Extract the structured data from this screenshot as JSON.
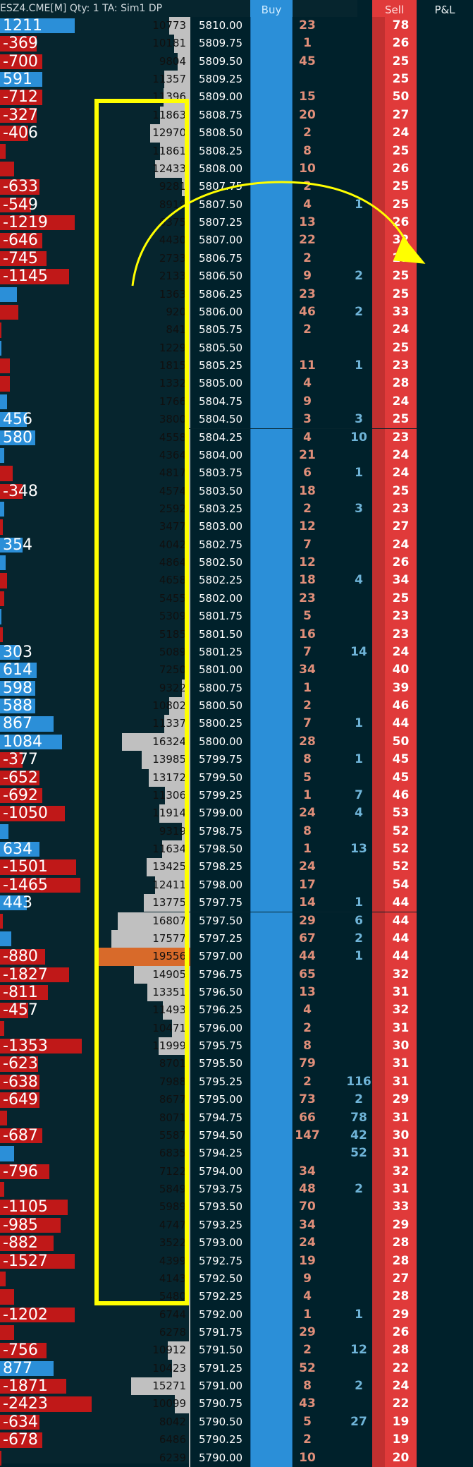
{
  "header": {
    "title": "ESZ4.CME[M] Qty: 1  TA: Sim1  DP",
    "buy_label": "Buy",
    "sell_label": "Sell",
    "pnl_label": "P&L"
  },
  "colors": {
    "positive_delta": "#2b8fd8",
    "negative_delta": "#c01818",
    "volume_bar": "#c0c0c0",
    "high_volume_bar": "#d86a2a",
    "buy_column": "#2b8fd8",
    "sell_column": "#e03a3a",
    "annotation": "#ffff00"
  },
  "volume_scale_max": 19556,
  "rows": [
    {
      "price": "5810.00",
      "delta": "1211",
      "delta_pct": 0.53,
      "volume": "10773",
      "trade1": "23",
      "trade2": "",
      "sell": "78"
    },
    {
      "price": "5809.75",
      "delta": "-369",
      "delta_pct": 0.26,
      "volume": "10181",
      "trade1": "1",
      "trade2": "",
      "sell": "26"
    },
    {
      "price": "5809.50",
      "delta": "-700",
      "delta_pct": 0.3,
      "volume": "9804",
      "trade1": "45",
      "trade2": "",
      "sell": "25"
    },
    {
      "price": "5809.25",
      "delta": "591",
      "delta_pct": 0.3,
      "volume": "11357",
      "trade1": "",
      "trade2": "",
      "sell": "25"
    },
    {
      "price": "5809.00",
      "delta": "-712",
      "delta_pct": 0.3,
      "volume": "11396",
      "trade1": "15",
      "trade2": "",
      "sell": "50"
    },
    {
      "price": "5808.75",
      "delta": "-327",
      "delta_pct": 0.26,
      "volume": "11863",
      "trade1": "20",
      "trade2": "",
      "sell": "27"
    },
    {
      "price": "5808.50",
      "delta": "-406",
      "delta_pct": 0.2,
      "volume": "12970",
      "trade1": "2",
      "trade2": "",
      "sell": "24"
    },
    {
      "price": "5808.25",
      "delta": "",
      "delta_pct": 0.04,
      "volume": "11861",
      "trade1": "8",
      "trade2": "",
      "sell": "25"
    },
    {
      "price": "5808.00",
      "delta": "",
      "delta_pct": 0.1,
      "volume": "12433",
      "trade1": "10",
      "trade2": "",
      "sell": "26"
    },
    {
      "price": "5807.75",
      "delta": "-633",
      "delta_pct": 0.28,
      "volume": "9281",
      "trade1": "2",
      "trade2": "",
      "sell": "25"
    },
    {
      "price": "5807.50",
      "delta": "-549",
      "delta_pct": 0.22,
      "volume": "8919",
      "trade1": "4",
      "trade2": "1",
      "sell": "25"
    },
    {
      "price": "5807.25",
      "delta": "-1219",
      "delta_pct": 0.53,
      "volume": "6375",
      "trade1": "13",
      "trade2": "",
      "sell": "26"
    },
    {
      "price": "5807.00",
      "delta": "-646",
      "delta_pct": 0.3,
      "volume": "4430",
      "trade1": "22",
      "trade2": "",
      "sell": "32"
    },
    {
      "price": "5806.75",
      "delta": "-745",
      "delta_pct": 0.33,
      "volume": "2733",
      "trade1": "2",
      "trade2": "",
      "sell": "27"
    },
    {
      "price": "5806.50",
      "delta": "-1145",
      "delta_pct": 0.49,
      "volume": "2133",
      "trade1": "9",
      "trade2": "2",
      "sell": "25"
    },
    {
      "price": "5806.25",
      "delta": "",
      "delta_pct": 0.12,
      "volume": "1363",
      "trade1": "23",
      "trade2": "",
      "sell": "25"
    },
    {
      "price": "5806.00",
      "delta": "",
      "delta_pct": 0.13,
      "volume": "920",
      "trade1": "46",
      "trade2": "2",
      "sell": "33"
    },
    {
      "price": "5805.75",
      "delta": "",
      "delta_pct": 0.01,
      "volume": "841",
      "trade1": "2",
      "trade2": "",
      "sell": "24"
    },
    {
      "price": "5805.50",
      "delta": "",
      "delta_pct": 0.01,
      "volume": "1229",
      "trade1": "",
      "trade2": "",
      "sell": "25"
    },
    {
      "price": "5805.25",
      "delta": "",
      "delta_pct": 0.07,
      "volume": "1815",
      "trade1": "11",
      "trade2": "1",
      "sell": "23"
    },
    {
      "price": "5805.00",
      "delta": "",
      "delta_pct": 0.07,
      "volume": "1332",
      "trade1": "4",
      "trade2": "",
      "sell": "28"
    },
    {
      "price": "5804.75",
      "delta": "",
      "delta_pct": 0.05,
      "volume": "1766",
      "trade1": "9",
      "trade2": "",
      "sell": "24"
    },
    {
      "price": "5804.50",
      "delta": "456",
      "delta_pct": 0.19,
      "volume": "3800",
      "trade1": "3",
      "trade2": "3",
      "sell": "25"
    },
    {
      "price": "5804.25",
      "delta": "580",
      "delta_pct": 0.25,
      "volume": "4558",
      "trade1": "4",
      "trade2": "10",
      "sell": "23"
    },
    {
      "price": "5804.00",
      "delta": "",
      "delta_pct": 0.03,
      "volume": "4364",
      "trade1": "21",
      "trade2": "",
      "sell": "24"
    },
    {
      "price": "5803.75",
      "delta": "",
      "delta_pct": 0.09,
      "volume": "4817",
      "trade1": "6",
      "trade2": "1",
      "sell": "24"
    },
    {
      "price": "5803.50",
      "delta": "-348",
      "delta_pct": 0.16,
      "volume": "4574",
      "trade1": "18",
      "trade2": "",
      "sell": "25"
    },
    {
      "price": "5803.25",
      "delta": "",
      "delta_pct": 0.03,
      "volume": "2592",
      "trade1": "2",
      "trade2": "3",
      "sell": "23"
    },
    {
      "price": "5803.00",
      "delta": "",
      "delta_pct": 0.02,
      "volume": "3477",
      "trade1": "12",
      "trade2": "",
      "sell": "27"
    },
    {
      "price": "5802.75",
      "delta": "354",
      "delta_pct": 0.16,
      "volume": "4042",
      "trade1": "7",
      "trade2": "",
      "sell": "24"
    },
    {
      "price": "5802.50",
      "delta": "",
      "delta_pct": 0.04,
      "volume": "4864",
      "trade1": "12",
      "trade2": "",
      "sell": "26"
    },
    {
      "price": "5802.25",
      "delta": "",
      "delta_pct": 0.05,
      "volume": "4658",
      "trade1": "18",
      "trade2": "4",
      "sell": "34"
    },
    {
      "price": "5802.00",
      "delta": "",
      "delta_pct": 0.03,
      "volume": "5455",
      "trade1": "23",
      "trade2": "",
      "sell": "25"
    },
    {
      "price": "5801.75",
      "delta": "",
      "delta_pct": 0.01,
      "volume": "5309",
      "trade1": "5",
      "trade2": "",
      "sell": "23"
    },
    {
      "price": "5801.50",
      "delta": "",
      "delta_pct": 0.02,
      "volume": "5185",
      "trade1": "16",
      "trade2": "",
      "sell": "23"
    },
    {
      "price": "5801.25",
      "delta": "303",
      "delta_pct": 0.14,
      "volume": "5089",
      "trade1": "7",
      "trade2": "14",
      "sell": "24"
    },
    {
      "price": "5801.00",
      "delta": "614",
      "delta_pct": 0.26,
      "volume": "7250",
      "trade1": "34",
      "trade2": "",
      "sell": "40"
    },
    {
      "price": "5800.75",
      "delta": "598",
      "delta_pct": 0.25,
      "volume": "9322",
      "trade1": "1",
      "trade2": "",
      "sell": "39"
    },
    {
      "price": "5800.50",
      "delta": "588",
      "delta_pct": 0.25,
      "volume": "10802",
      "trade1": "2",
      "trade2": "",
      "sell": "46"
    },
    {
      "price": "5800.25",
      "delta": "867",
      "delta_pct": 0.38,
      "volume": "11337",
      "trade1": "7",
      "trade2": "1",
      "sell": "44"
    },
    {
      "price": "5800.00",
      "delta": "1084",
      "delta_pct": 0.44,
      "volume": "16324",
      "trade1": "28",
      "trade2": "",
      "sell": "50"
    },
    {
      "price": "5799.75",
      "delta": "-377",
      "delta_pct": 0.16,
      "volume": "13985",
      "trade1": "8",
      "trade2": "1",
      "sell": "45"
    },
    {
      "price": "5799.50",
      "delta": "-652",
      "delta_pct": 0.28,
      "volume": "13172",
      "trade1": "5",
      "trade2": "",
      "sell": "45"
    },
    {
      "price": "5799.25",
      "delta": "-692",
      "delta_pct": 0.3,
      "volume": "11306",
      "trade1": "1",
      "trade2": "7",
      "sell": "46"
    },
    {
      "price": "5799.00",
      "delta": "-1050",
      "delta_pct": 0.46,
      "volume": "11914",
      "trade1": "24",
      "trade2": "4",
      "sell": "53"
    },
    {
      "price": "5798.75",
      "delta": "",
      "delta_pct": 0.06,
      "volume": "9319",
      "trade1": "8",
      "trade2": "",
      "sell": "52"
    },
    {
      "price": "5798.50",
      "delta": "634",
      "delta_pct": 0.28,
      "volume": "11634",
      "trade1": "1",
      "trade2": "13",
      "sell": "52"
    },
    {
      "price": "5798.25",
      "delta": "-1501",
      "delta_pct": 0.54,
      "volume": "13425",
      "trade1": "24",
      "trade2": "",
      "sell": "52"
    },
    {
      "price": "5798.00",
      "delta": "-1465",
      "delta_pct": 0.57,
      "volume": "12411",
      "trade1": "17",
      "trade2": "",
      "sell": "54"
    },
    {
      "price": "5797.75",
      "delta": "443",
      "delta_pct": 0.19,
      "volume": "13775",
      "trade1": "14",
      "trade2": "1",
      "sell": "44"
    },
    {
      "price": "5797.50",
      "delta": "",
      "delta_pct": 0.02,
      "volume": "16807",
      "trade1": "29",
      "trade2": "6",
      "sell": "44"
    },
    {
      "price": "5797.25",
      "delta": "",
      "delta_pct": 0.08,
      "volume": "17577",
      "trade1": "67",
      "trade2": "2",
      "sell": "44"
    },
    {
      "price": "5797.00",
      "delta": "-880",
      "delta_pct": 0.32,
      "volume": "19556",
      "trade1": "44",
      "trade2": "1",
      "sell": "44",
      "highlight": true
    },
    {
      "price": "5796.75",
      "delta": "-1827",
      "delta_pct": 0.49,
      "volume": "14905",
      "trade1": "65",
      "trade2": "",
      "sell": "32"
    },
    {
      "price": "5796.50",
      "delta": "-811",
      "delta_pct": 0.34,
      "volume": "13351",
      "trade1": "13",
      "trade2": "",
      "sell": "31"
    },
    {
      "price": "5796.25",
      "delta": "-457",
      "delta_pct": 0.2,
      "volume": "11493",
      "trade1": "4",
      "trade2": "",
      "sell": "32"
    },
    {
      "price": "5796.00",
      "delta": "",
      "delta_pct": 0.03,
      "volume": "10471",
      "trade1": "2",
      "trade2": "",
      "sell": "31"
    },
    {
      "price": "5795.75",
      "delta": "-1353",
      "delta_pct": 0.58,
      "volume": "11999",
      "trade1": "8",
      "trade2": "",
      "sell": "30"
    },
    {
      "price": "5795.50",
      "delta": "-623",
      "delta_pct": 0.27,
      "volume": "8701",
      "trade1": "79",
      "trade2": "",
      "sell": "31"
    },
    {
      "price": "5795.25",
      "delta": "-638",
      "delta_pct": 0.28,
      "volume": "7988",
      "trade1": "2",
      "trade2": "116",
      "sell": "31"
    },
    {
      "price": "5795.00",
      "delta": "-649",
      "delta_pct": 0.28,
      "volume": "8677",
      "trade1": "73",
      "trade2": "2",
      "sell": "29"
    },
    {
      "price": "5794.75",
      "delta": "",
      "delta_pct": 0.05,
      "volume": "8071",
      "trade1": "66",
      "trade2": "78",
      "sell": "31"
    },
    {
      "price": "5794.50",
      "delta": "-687",
      "delta_pct": 0.3,
      "volume": "5587",
      "trade1": "147",
      "trade2": "42",
      "sell": "30"
    },
    {
      "price": "5794.25",
      "delta": "",
      "delta_pct": 0.1,
      "volume": "6835",
      "trade1": "",
      "trade2": "52",
      "sell": "31"
    },
    {
      "price": "5794.00",
      "delta": "-796",
      "delta_pct": 0.35,
      "volume": "7122",
      "trade1": "34",
      "trade2": "",
      "sell": "32"
    },
    {
      "price": "5793.75",
      "delta": "",
      "delta_pct": 0.03,
      "volume": "5849",
      "trade1": "48",
      "trade2": "2",
      "sell": "31"
    },
    {
      "price": "5793.50",
      "delta": "-1105",
      "delta_pct": 0.48,
      "volume": "5989",
      "trade1": "70",
      "trade2": "",
      "sell": "33"
    },
    {
      "price": "5793.25",
      "delta": "-985",
      "delta_pct": 0.43,
      "volume": "4747",
      "trade1": "34",
      "trade2": "",
      "sell": "29"
    },
    {
      "price": "5793.00",
      "delta": "-882",
      "delta_pct": 0.38,
      "volume": "3522",
      "trade1": "24",
      "trade2": "",
      "sell": "28"
    },
    {
      "price": "5792.75",
      "delta": "-1527",
      "delta_pct": 0.53,
      "volume": "4399",
      "trade1": "19",
      "trade2": "",
      "sell": "28"
    },
    {
      "price": "5792.50",
      "delta": "",
      "delta_pct": 0.04,
      "volume": "4143",
      "trade1": "9",
      "trade2": "",
      "sell": "27"
    },
    {
      "price": "5792.25",
      "delta": "",
      "delta_pct": 0.1,
      "volume": "5480",
      "trade1": "4",
      "trade2": "",
      "sell": "28"
    },
    {
      "price": "5792.00",
      "delta": "-1202",
      "delta_pct": 0.53,
      "volume": "6744",
      "trade1": "1",
      "trade2": "1",
      "sell": "29"
    },
    {
      "price": "5791.75",
      "delta": "",
      "delta_pct": 0.1,
      "volume": "6278",
      "trade1": "29",
      "trade2": "",
      "sell": "26"
    },
    {
      "price": "5791.50",
      "delta": "-756",
      "delta_pct": 0.33,
      "volume": "10912",
      "trade1": "2",
      "trade2": "12",
      "sell": "28"
    },
    {
      "price": "5791.25",
      "delta": "877",
      "delta_pct": 0.38,
      "volume": "10423",
      "trade1": "52",
      "trade2": "",
      "sell": "22"
    },
    {
      "price": "5791.00",
      "delta": "-1871",
      "delta_pct": 0.47,
      "volume": "15271",
      "trade1": "8",
      "trade2": "2",
      "sell": "24"
    },
    {
      "price": "5790.75",
      "delta": "-2423",
      "delta_pct": 0.65,
      "volume": "10099",
      "trade1": "43",
      "trade2": "",
      "sell": "22"
    },
    {
      "price": "5790.50",
      "delta": "-634",
      "delta_pct": 0.28,
      "volume": "8042",
      "trade1": "5",
      "trade2": "27",
      "sell": "19"
    },
    {
      "price": "5790.25",
      "delta": "-678",
      "delta_pct": 0.3,
      "volume": "6486",
      "trade1": "2",
      "trade2": "",
      "sell": "19"
    },
    {
      "price": "5790.00",
      "delta": "",
      "delta_pct": 0.01,
      "volume": "6239",
      "trade1": "10",
      "trade2": "",
      "sell": "20"
    }
  ]
}
